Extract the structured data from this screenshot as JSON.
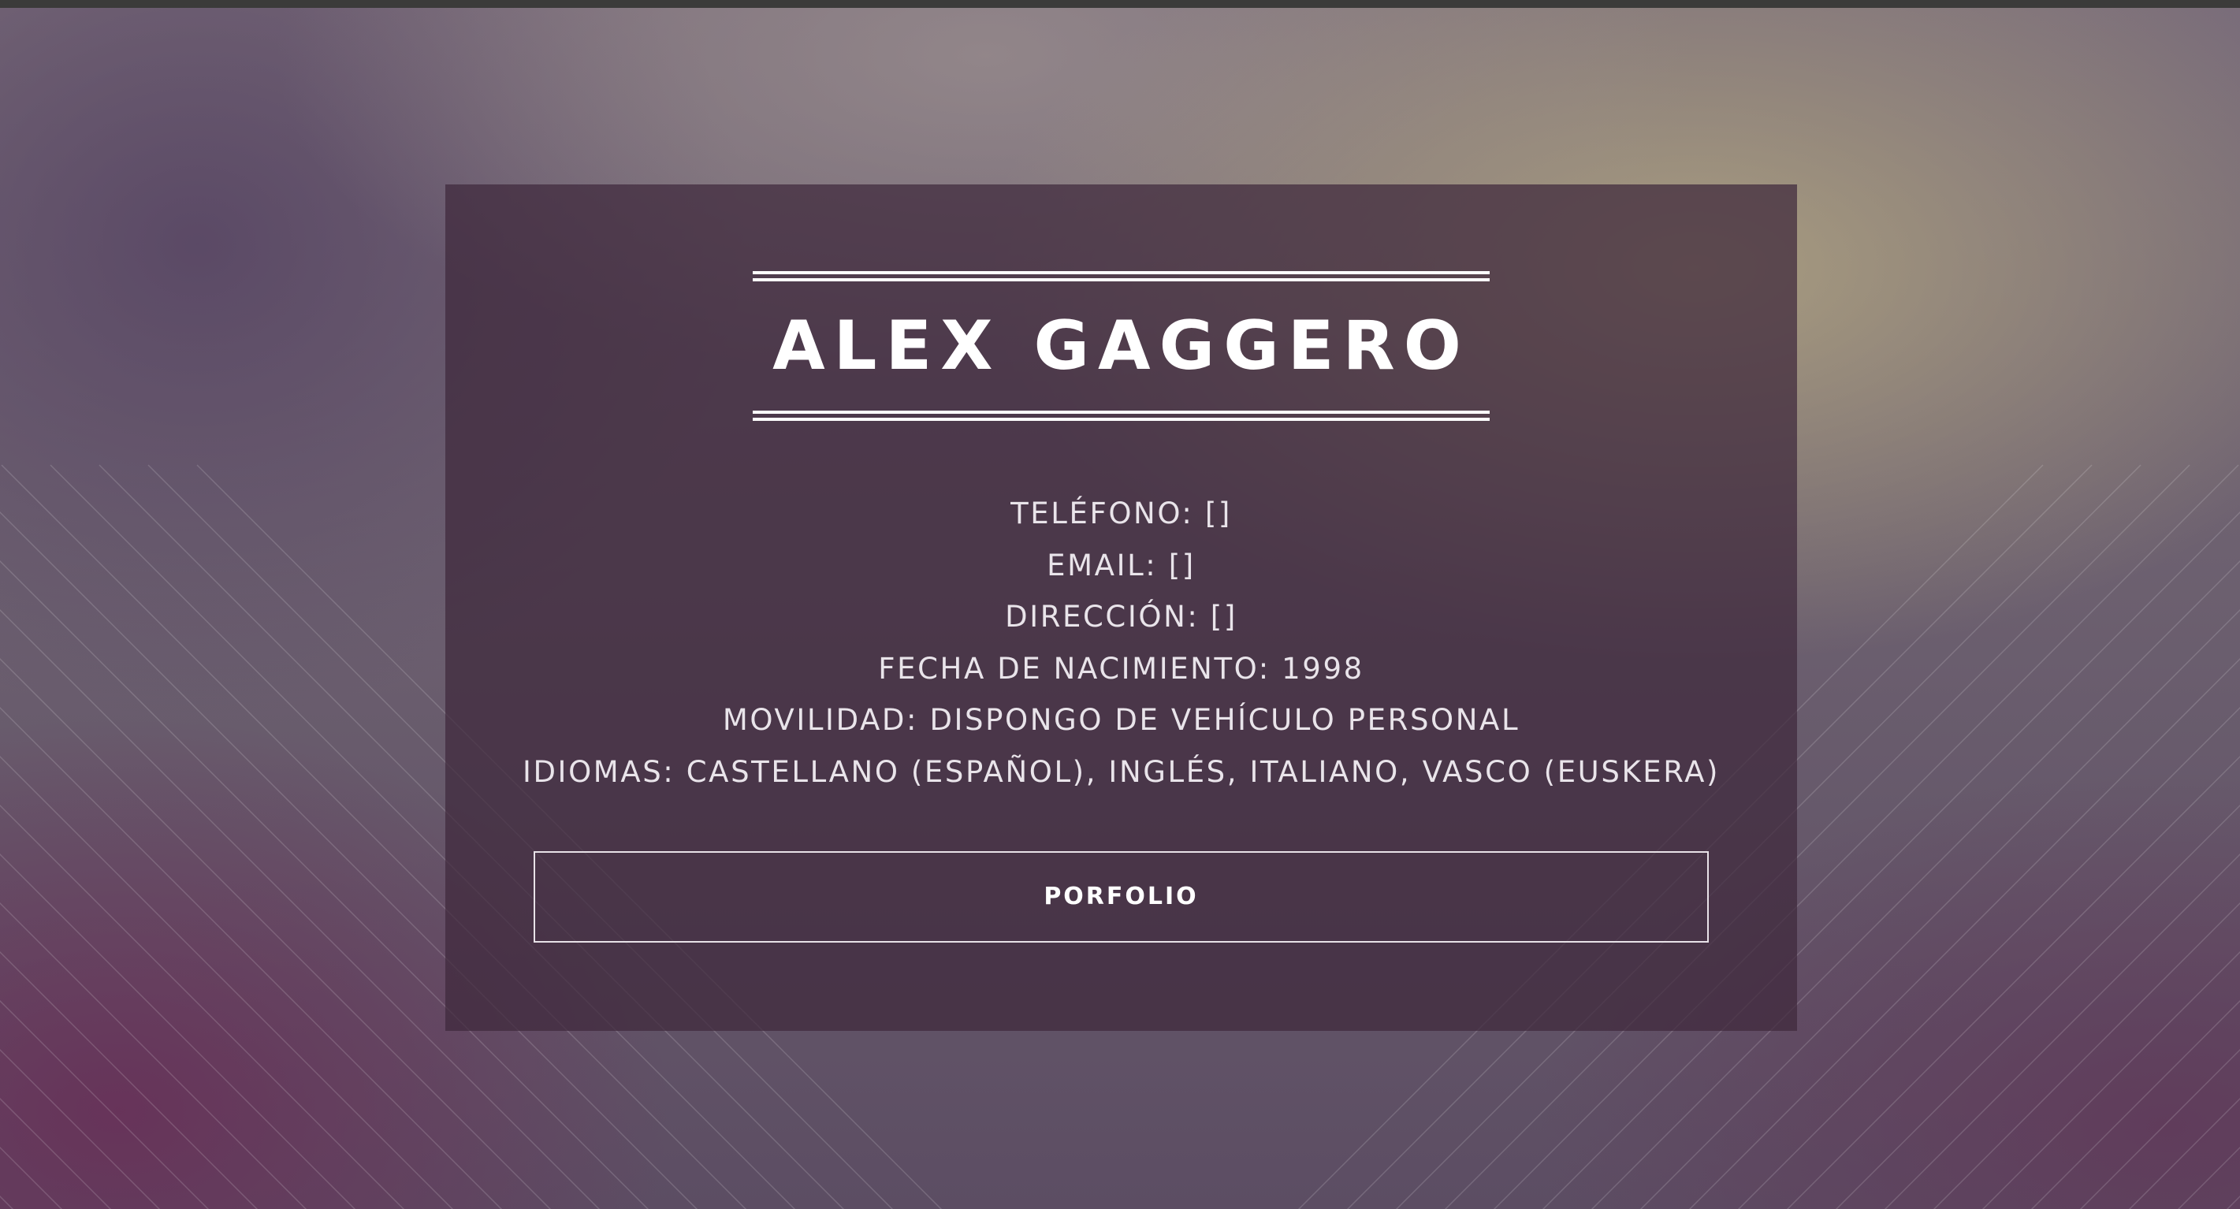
{
  "profile": {
    "name": "ALEX GAGGERO",
    "details": [
      "TELÉFONO: []",
      "EMAIL: []",
      "DIRECCIÓN: []",
      "FECHA DE NACIMIENTO: 1998",
      "MOVILIDAD: DISPONGO DE VEHÍCULO PERSONAL",
      "IDIOMAS: CASTELLANO (ESPAÑOL), INGLÉS, ITALIANO, VASCO (EUSKERA)"
    ],
    "button_label": "PORFOLIO"
  },
  "colors": {
    "card_background": "#3e283c",
    "text": "#ffffff",
    "top_bar": "#3b3b3a"
  }
}
